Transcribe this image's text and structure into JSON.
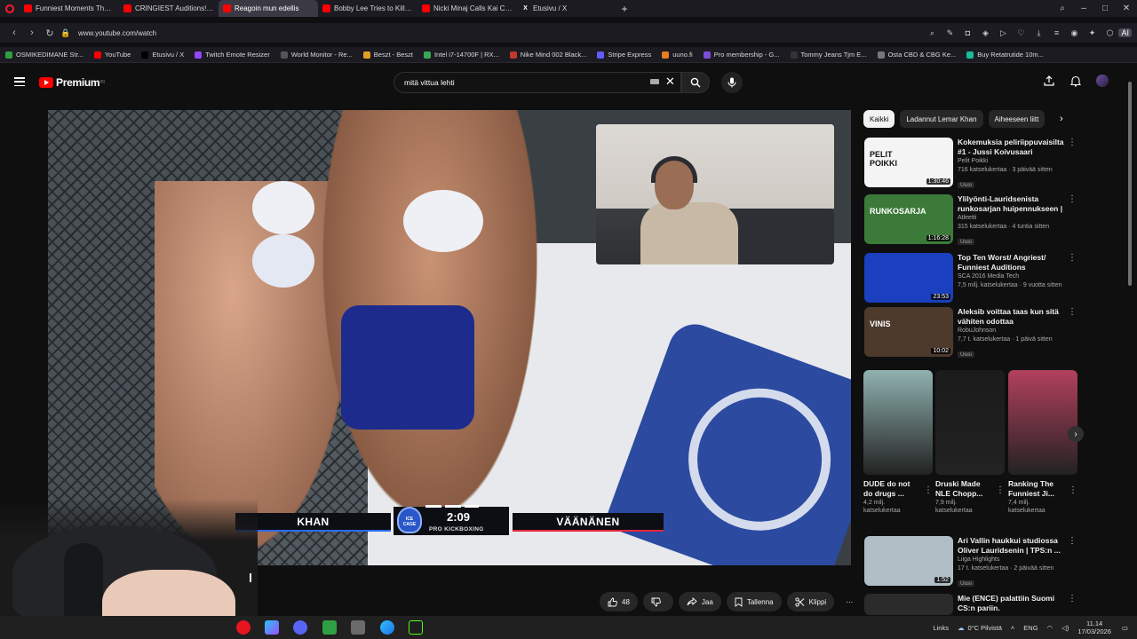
{
  "browser": {
    "tabs": [
      {
        "title": "Funniest Moments That M",
        "icon": "youtube-icon",
        "active": false
      },
      {
        "title": "CRINGIEST Auditions! Try",
        "icon": "youtube-icon",
        "active": false
      },
      {
        "title": "Reagoin mun edellis",
        "icon": "youtube-icon",
        "active": true
      },
      {
        "title": "Bobby Lee Tries to Kill An",
        "icon": "youtube-icon",
        "active": false
      },
      {
        "title": "Nicki Minaj Calls Kai Cen",
        "icon": "youtube-icon",
        "active": false
      },
      {
        "title": "Etusivu / X",
        "icon": "x-icon",
        "active": false
      }
    ],
    "url": "www.youtube.com/watch",
    "ai_label": "AI",
    "bookmarks": [
      {
        "label": "OSMIKEDIMANE Str...",
        "color": "#2ea043"
      },
      {
        "label": "YouTube",
        "color": "#ff0000"
      },
      {
        "label": "Etusivu / X",
        "color": "#000000"
      },
      {
        "label": "Twitch Emote Resizer",
        "color": "#9146ff"
      },
      {
        "label": "World Monitor - Re...",
        "color": "#555555"
      },
      {
        "label": "Beszt - Beszt",
        "color": "#e0a020"
      },
      {
        "label": "Intel i7-14700F | RX...",
        "color": "#3aa655"
      },
      {
        "label": "Nike Mind 002 Black...",
        "color": "#c0392b"
      },
      {
        "label": "Stripe Express",
        "color": "#635bff"
      },
      {
        "label": "uuno.fi",
        "color": "#e67e22"
      },
      {
        "label": "Pro membership - G...",
        "color": "#7a4fd6"
      },
      {
        "label": "Tommy Jeans Tjm E...",
        "color": "#333333"
      },
      {
        "label": "Osta CBD & CBG Ke...",
        "color": "#777777"
      },
      {
        "label": "Buy Retatrutide 10m...",
        "color": "#1abc9c"
      }
    ]
  },
  "youtube": {
    "logo_text": "Premium",
    "logo_sup": "FI",
    "search_value": "mitä vittua lehti",
    "chips": [
      {
        "label": "Kaikki",
        "active": true
      },
      {
        "label": "Ladannut Lemar Khan",
        "active": false
      },
      {
        "label": "Aiheeseen liitt",
        "active": false
      }
    ],
    "recommendations": [
      {
        "title": "Kokemuksia peliriippuvaisilta #1 - Jussi Koivusaari",
        "channel": "Pelit Poikki",
        "meta": "716 katselukertaa · 3 päivää sitten",
        "badge": "Uusi",
        "duration": "1:30:46",
        "thumb_color": "#f4f4f4",
        "thumb_text": "PELIT POIKKI"
      },
      {
        "title": "Ylilyönti-Lauridsenista runkosarjan huipennukseen | ...",
        "channel": "Atleetti",
        "meta": "315 katselukertaa · 4 tuntia sitten",
        "badge": "Uusi",
        "duration": "1:16:28",
        "thumb_color": "#3c7a3a",
        "thumb_text": "RUNKOSARJA"
      },
      {
        "title": "Top Ten Worst/ Angriest/ Funniest Auditions",
        "channel": "SCA 2016 Media Tech",
        "meta": "7,5 milj. katselukertaa · 9 vuotta sitten",
        "badge": "",
        "duration": "23:53",
        "thumb_color": "#1a3fbf",
        "thumb_text": ""
      },
      {
        "title": "Aleksib voittaa taas kun sitä vähiten odottaa",
        "channel": "RobuJohnson",
        "meta": "7,7 t. katselukertaa · 1 päivä sitten",
        "badge": "Uusi",
        "duration": "10:02",
        "thumb_color": "#4d3a2c",
        "thumb_text": "VINIS"
      },
      {
        "title": "Ari Vallin haukkui studiossa Oliver Lauridsenin | TPS:n ...",
        "channel": "Liiga Highlights",
        "meta": "17 t. katselukertaa · 2 päivää sitten",
        "badge": "Uusi",
        "duration": "1:52",
        "thumb_color": "#b0bec5",
        "thumb_text": ""
      },
      {
        "title": "Mie (ENCE) palattiin Suomi CS:n pariin.",
        "channel": "",
        "meta": "",
        "badge": "",
        "duration": "",
        "thumb_color": "#2b2b2b",
        "thumb_text": ""
      }
    ],
    "shorts": [
      {
        "title": "DUDE do not do drugs ...",
        "views": "4,2 milj.",
        "views_label": "katselukertaa",
        "color": "#8fb2b0"
      },
      {
        "title": "Druski Made NLE Chopp...",
        "views": "7,9 milj.",
        "views_label": "katselukertaa",
        "color": "#1b1b1b"
      },
      {
        "title": "Ranking The Funniest Ji...",
        "views": "7,4 milj.",
        "views_label": "katselukertaa",
        "color": "#b3405d"
      }
    ],
    "actions": {
      "likes": "48",
      "share": "Jaa",
      "save": "Tallenna",
      "clip": "Klippi"
    }
  },
  "video": {
    "fighter_left": "KHAN",
    "fighter_right": "VÄÄNÄNEN",
    "clock": "2:09",
    "event": "PRO KICKBOXING",
    "logo_text": "ICE CAGE"
  },
  "taskbar": {
    "links_label": "Links",
    "weather": "0°C Pilvistä",
    "language": "ENG",
    "time": "11.14",
    "date": "17/03/2026"
  }
}
